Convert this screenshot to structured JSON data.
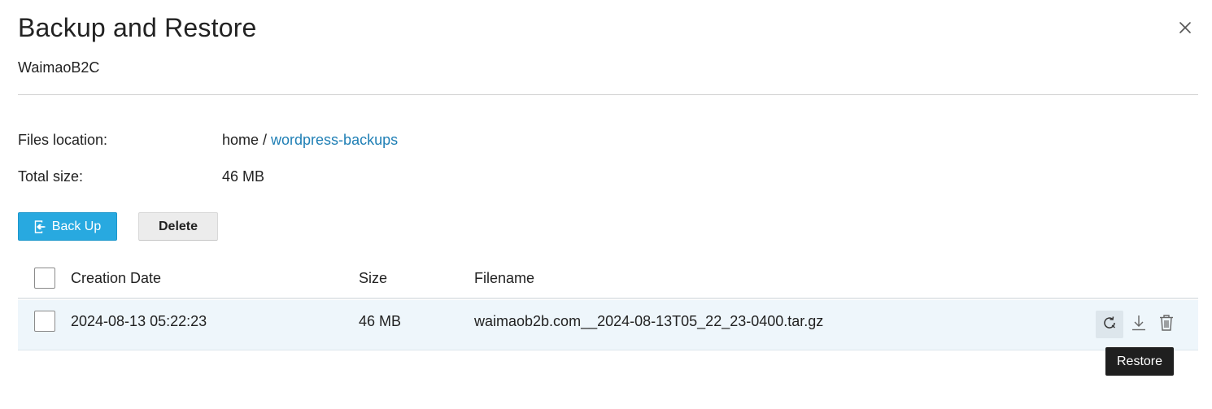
{
  "dialog": {
    "title": "Backup and Restore",
    "subtitle": "WaimaoB2C",
    "close_icon": "close-icon"
  },
  "info": {
    "files_location_label": "Files location:",
    "files_location_prefix": "home / ",
    "files_location_link": "wordpress-backups",
    "total_size_label": "Total size:",
    "total_size_value": "46 MB"
  },
  "toolbar": {
    "backup_label": "Back Up",
    "backup_icon": "backup-export-icon",
    "delete_label": "Delete"
  },
  "table": {
    "columns": [
      "Creation Date",
      "Size",
      "Filename"
    ],
    "rows": [
      {
        "date": "2024-08-13 05:22:23",
        "size": "46 MB",
        "filename": "waimaob2b.com__2024-08-13T05_22_23-0400.tar.gz",
        "actions": [
          "restore-icon",
          "download-icon",
          "trash-icon"
        ]
      }
    ]
  },
  "tooltip": {
    "text": "Restore"
  },
  "colors": {
    "primary": "#28a9e0",
    "link": "#1f7fb5",
    "row_highlight": "#eef6fb",
    "tooltip_bg": "#1f1f1f"
  }
}
